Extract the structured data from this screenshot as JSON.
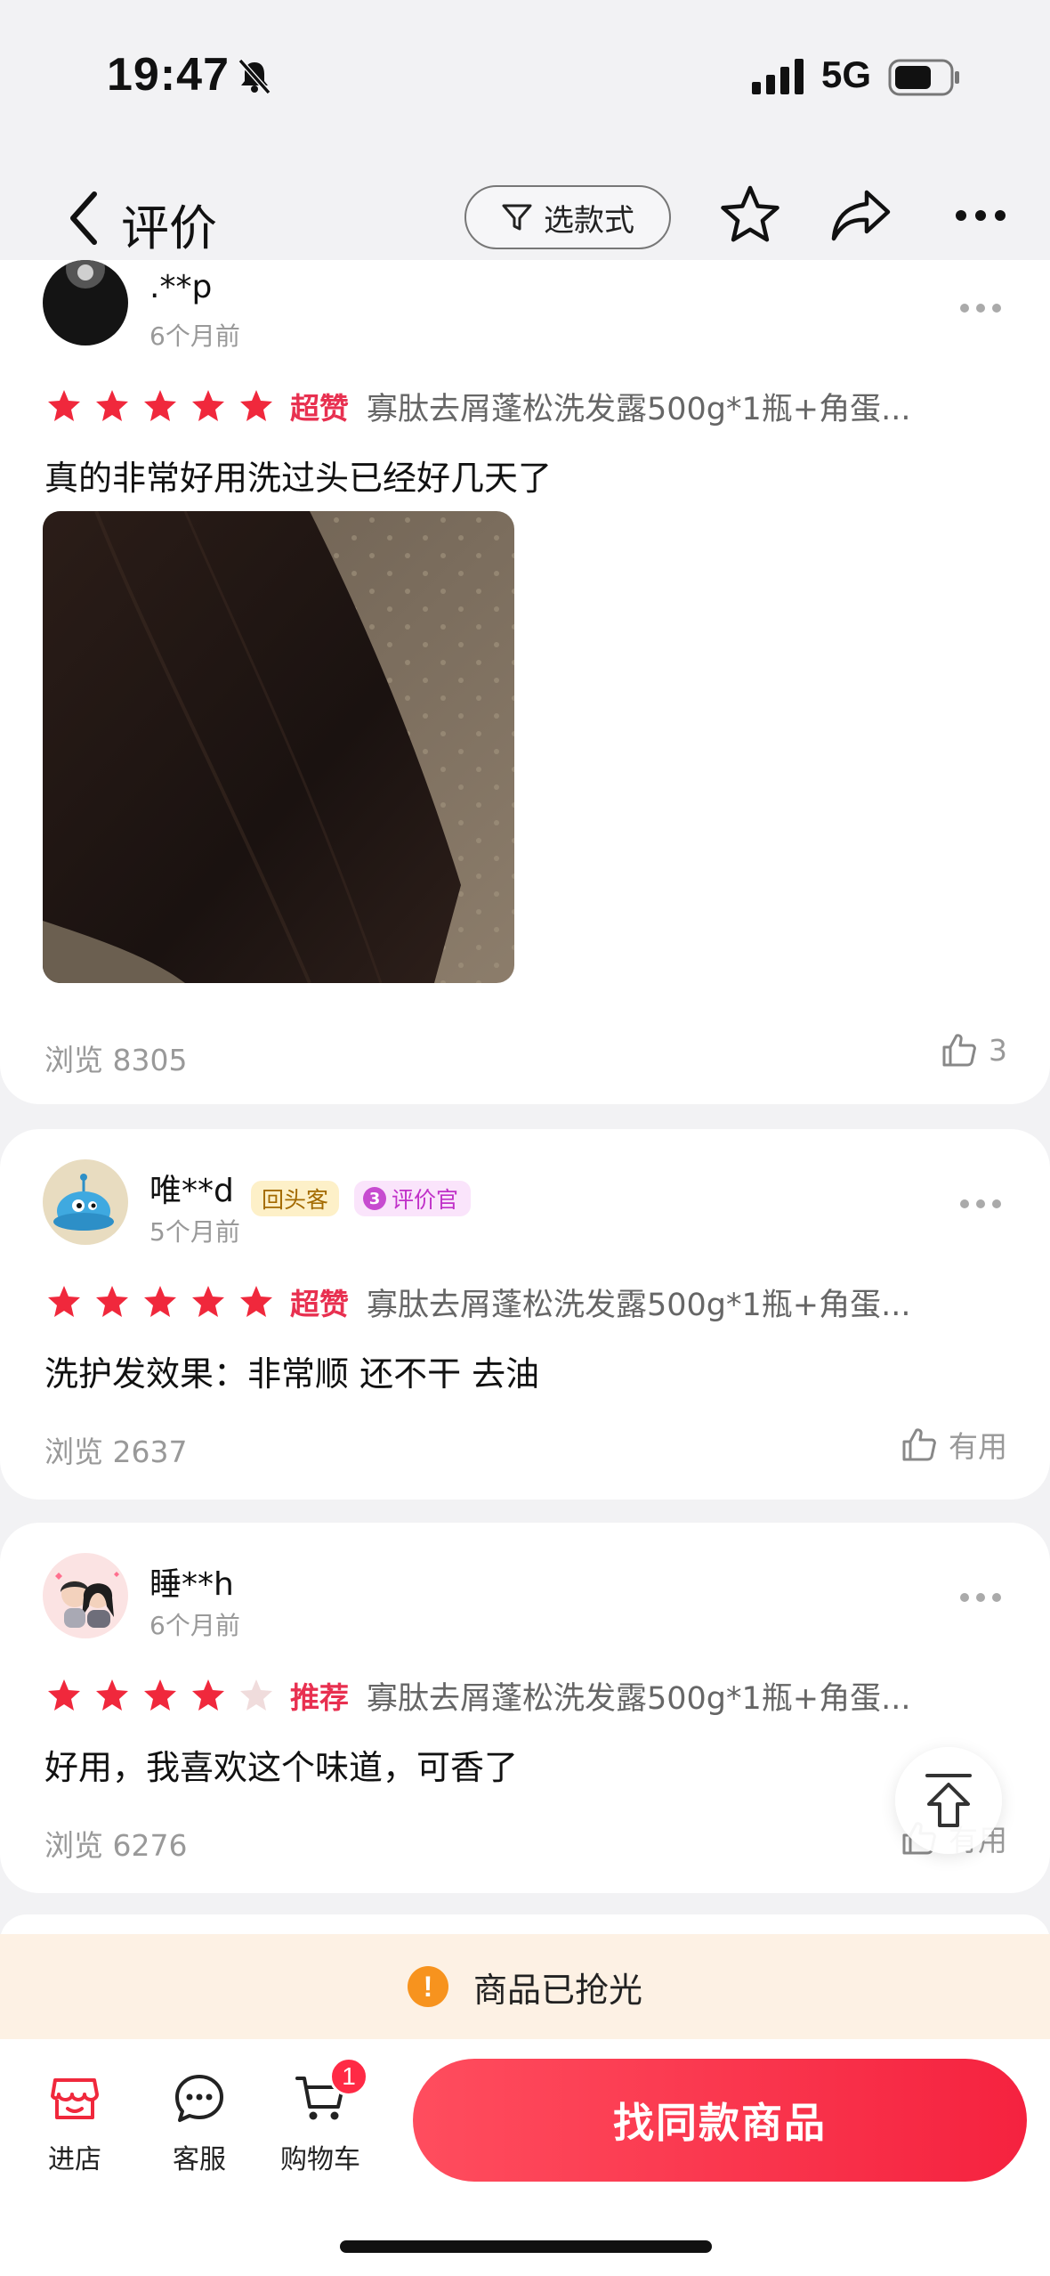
{
  "status_bar": {
    "time": "19:47",
    "network": "5G"
  },
  "nav": {
    "title": "评价",
    "filter_label": "选款式"
  },
  "reviews": [
    {
      "user": ".**p",
      "time": "6个月前",
      "rating": 5,
      "rating_label": "超赞",
      "sku": "寡肽去屑蓬松洗发露500g*1瓶+角蛋...",
      "text": "真的非常好用洗过头已经好几天了",
      "views": "浏览 8305",
      "like": "3",
      "has_photo": true
    },
    {
      "user": "唯**d",
      "badges": [
        "回头客",
        "评价官"
      ],
      "badge_level": "3",
      "time": "5个月前",
      "rating": 5,
      "rating_label": "超赞",
      "sku": "寡肽去屑蓬松洗发露500g*1瓶+角蛋...",
      "text": "洗护发效果：非常顺 还不干 去油",
      "views": "浏览 2637",
      "like": "有用"
    },
    {
      "user": "睡**h",
      "time": "6个月前",
      "rating": 4,
      "rating_label": "推荐",
      "sku": "寡肽去屑蓬松洗发露500g*1瓶+角蛋...",
      "text": "好用，我喜欢这个味道，可香了",
      "views": "浏览 6276",
      "like": "有用"
    }
  ],
  "banner": {
    "soldout_text": "商品已抢光",
    "alert_glyph": "!"
  },
  "bottom_bar": {
    "tabs": [
      {
        "label": "进店",
        "icon": "store-icon"
      },
      {
        "label": "客服",
        "icon": "chat-icon"
      },
      {
        "label": "购物车",
        "icon": "cart-icon",
        "badge": "1"
      }
    ],
    "cta": "找同款商品"
  },
  "colors": {
    "accent": "#f5223f",
    "star_on": "#f0283c",
    "star_off": "#f0dcdc",
    "rating_label": "#e83050",
    "banner_bg": "#fdf1e4",
    "alert": "#f7931e"
  }
}
